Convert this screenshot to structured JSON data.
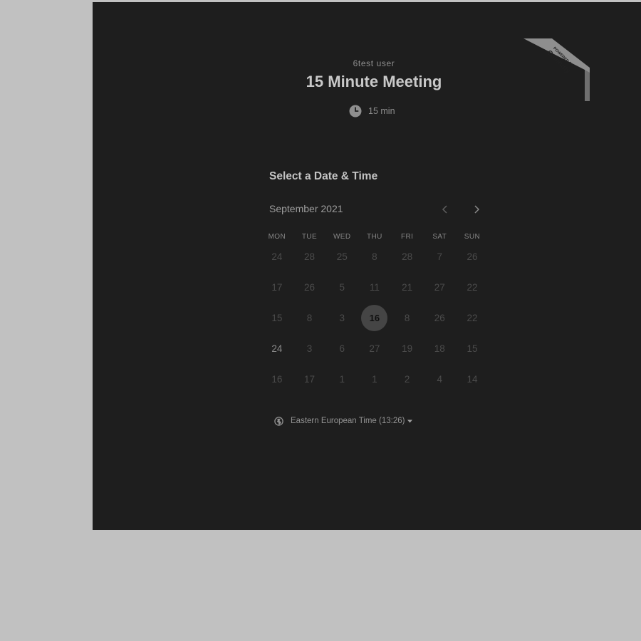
{
  "event": {
    "owner": "6test user",
    "title": "15 Minute Meeting",
    "duration": "15 min"
  },
  "badge": {
    "line1": "POWERED BY",
    "line2": "Calendly",
    "icon": "calendly-ribbon"
  },
  "calendar": {
    "heading": "Select a Date & Time",
    "month": "September 2021",
    "prev_icon": "chevron-left-icon",
    "next_icon": "chevron-right-icon",
    "weekdays": [
      "MON",
      "TUE",
      "WED",
      "THU",
      "FRI",
      "SAT",
      "SUN"
    ],
    "weeks": [
      [
        "24",
        "28",
        "25",
        "8",
        "28",
        "7",
        "26"
      ],
      [
        "17",
        "26",
        "5",
        "11",
        "21",
        "27",
        "22"
      ],
      [
        "15",
        "8",
        "3",
        "16",
        "8",
        "26",
        "22"
      ],
      [
        "24",
        "3",
        "6",
        "27",
        "19",
        "18",
        "15"
      ],
      [
        "16",
        "17",
        "1",
        "1",
        "2",
        "4",
        "14"
      ]
    ],
    "selected_day": "16"
  },
  "timezone": {
    "label": "Eastern European Time (13:26)",
    "icon": "globe-icon"
  },
  "colors": {
    "page_bg": "#c1c1c1",
    "panel_bg": "#1e1e1e",
    "selected_bg": "#454545"
  }
}
